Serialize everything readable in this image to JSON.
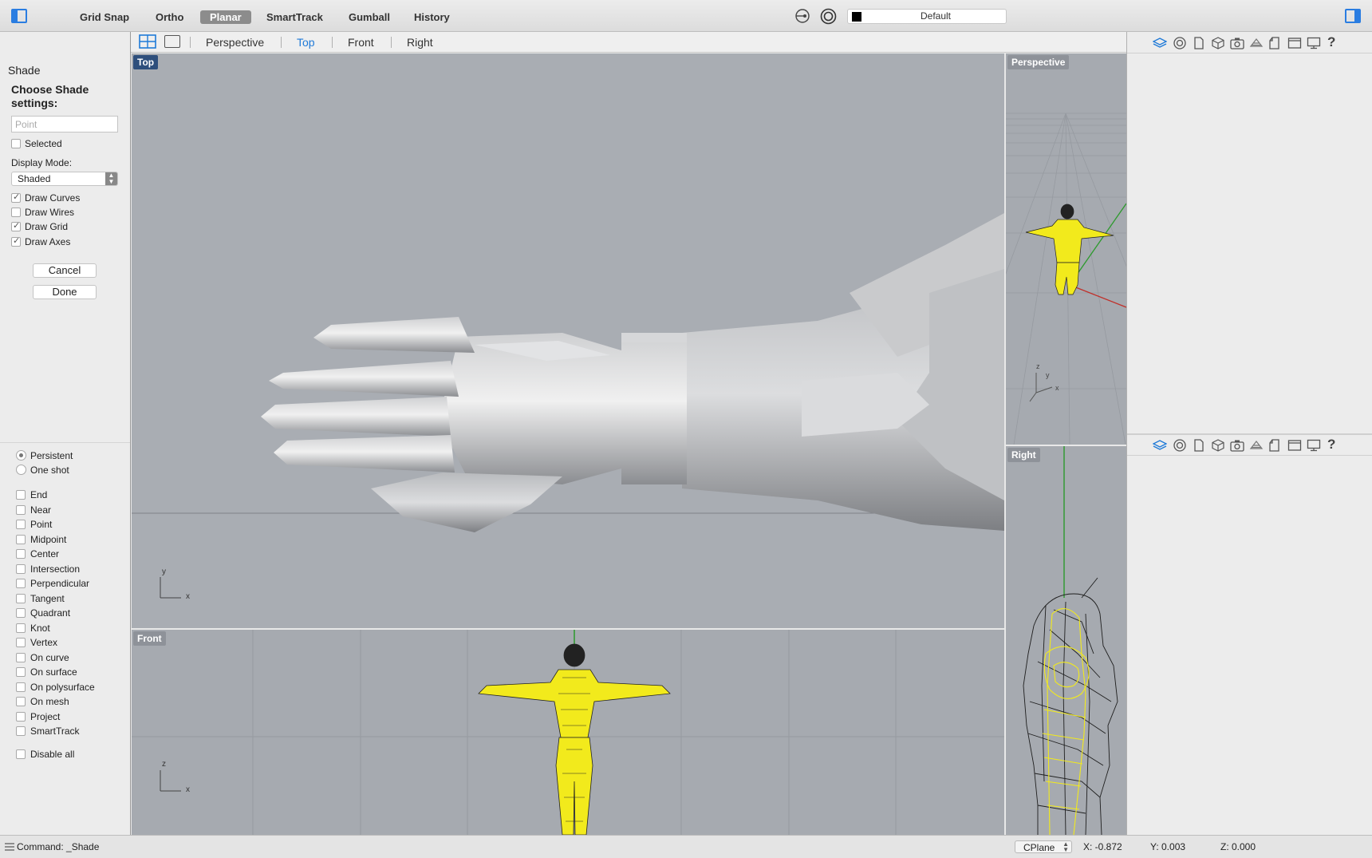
{
  "toolbar": {
    "modes": [
      {
        "label": "Grid Snap",
        "active": false
      },
      {
        "label": "Ortho",
        "active": false
      },
      {
        "label": "Planar",
        "active": true
      },
      {
        "label": "SmartTrack",
        "active": false
      },
      {
        "label": "Gumball",
        "active": false
      },
      {
        "label": "History",
        "active": false
      }
    ],
    "layer": {
      "name": "Default",
      "color": "#000000"
    }
  },
  "viewport_tabs": {
    "items": [
      {
        "label": "Perspective",
        "active": false
      },
      {
        "label": "Top",
        "active": true
      },
      {
        "label": "Front",
        "active": false
      },
      {
        "label": "Right",
        "active": false
      }
    ]
  },
  "shade_panel": {
    "title": "Shade",
    "prompt": "Choose Shade settings:",
    "point_placeholder": "Point",
    "selected_label": "Selected",
    "selected_checked": false,
    "display_mode_label": "Display Mode:",
    "display_mode_value": "Shaded",
    "options": [
      {
        "label": "Draw Curves",
        "checked": true
      },
      {
        "label": "Draw Wires",
        "checked": false
      },
      {
        "label": "Draw Grid",
        "checked": true
      },
      {
        "label": "Draw Axes",
        "checked": true
      }
    ],
    "cancel_label": "Cancel",
    "done_label": "Done"
  },
  "osnap_panel": {
    "modes": [
      {
        "label": "Persistent",
        "selected": true
      },
      {
        "label": "One shot",
        "selected": false
      }
    ],
    "snaps": [
      "End",
      "Near",
      "Point",
      "Midpoint",
      "Center",
      "Intersection",
      "Perpendicular",
      "Tangent",
      "Quadrant",
      "Knot",
      "Vertex",
      "On curve",
      "On surface",
      "On polysurface",
      "On mesh",
      "Project",
      "SmartTrack"
    ],
    "disable_all_label": "Disable all"
  },
  "viewports": {
    "top": {
      "label": "Top",
      "axis_labels": [
        "y",
        "x"
      ]
    },
    "front": {
      "label": "Front",
      "axis_labels": [
        "z",
        "x"
      ]
    },
    "perspective": {
      "label": "Perspective",
      "axis_labels": [
        "z",
        "y",
        "x"
      ]
    },
    "right": {
      "label": "Right"
    }
  },
  "statusbar": {
    "command": "Command: _Shade",
    "cplane": "CPlane",
    "x": "X: -0.872",
    "y": "Y: 0.003",
    "z": "Z: 0.000"
  },
  "colors": {
    "accent": "#1f7ad8",
    "viewport_bg": "#a6aab0",
    "active_label": "#2e4f7c",
    "wire_yellow": "#f2ea1c",
    "axis_green": "#2c9a2c",
    "axis_red": "#c0302a"
  },
  "icons": {
    "left_panel_toggle": "sidebar-left-icon",
    "right_panel_toggle": "sidebar-right-icon",
    "gumball": "gumball-icon",
    "record": "record-history-icon",
    "panel_tabs": [
      "layers-icon",
      "properties-icon",
      "document-icon",
      "object-icon",
      "camera-icon",
      "materials-icon",
      "text-icon",
      "window-icon",
      "display-icon",
      "help-icon"
    ]
  }
}
